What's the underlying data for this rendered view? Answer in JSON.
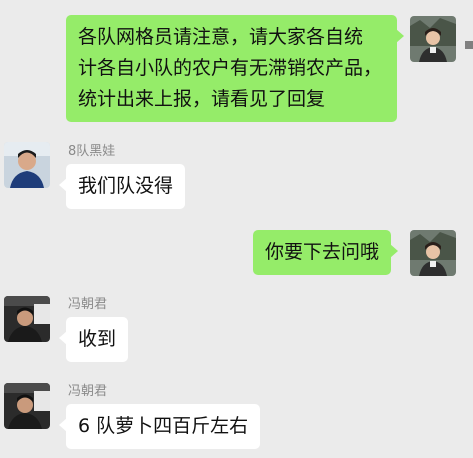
{
  "messages": [
    {
      "direction": "outgoing",
      "lines": [
        "各队网格员请注意，请大家各自统",
        "计各自小队的农户有无滞销农产品，",
        "统计出来上报，请看见了回复"
      ]
    },
    {
      "direction": "incoming",
      "sender": "8队黑娃",
      "text": "我们队没得"
    },
    {
      "direction": "outgoing",
      "text": "你要下去问哦"
    },
    {
      "direction": "incoming",
      "sender": "冯朝君",
      "text": "收到"
    },
    {
      "direction": "incoming",
      "sender": "冯朝君",
      "text": "6 队萝卜四百斤左右"
    }
  ],
  "colors": {
    "background": "#ebebeb",
    "outgoing_bubble": "#95ec69",
    "incoming_bubble": "#ffffff",
    "sender_name": "#8a8a8a"
  }
}
